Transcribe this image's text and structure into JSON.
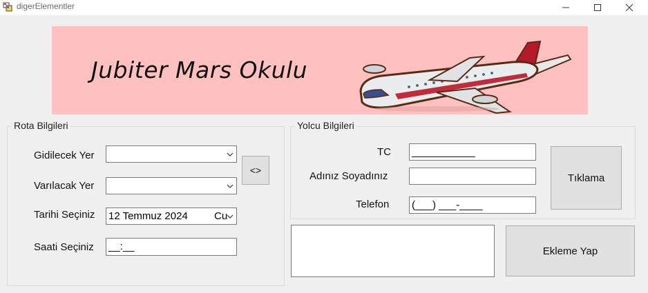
{
  "window": {
    "title": "digerElementler"
  },
  "banner": {
    "title": "Jubiter Mars Okulu",
    "background": "#ffc0c0"
  },
  "route_group": {
    "label": "Rota Bilgileri",
    "destination_label": "Gidilecek Yer",
    "destination_value": "",
    "arrival_label": "Varılacak Yer",
    "arrival_value": "",
    "date_label": "Tarihi Seçiniz",
    "date_value": "12 Temmuz 2024",
    "date_day": "Cu",
    "time_label": "Saati Seçiniz",
    "time_value": "__:__",
    "swap_button": "<>"
  },
  "passenger_group": {
    "label": "Yolcu Bilgileri",
    "tc_label": "TC",
    "tc_value": "___________",
    "name_label": "Adınız Soyadınız",
    "name_value": "",
    "phone_label": "Telefon",
    "phone_value": "(___) ___-____",
    "click_button": "Tıklama"
  },
  "notes_value": "",
  "add_button": "Ekleme Yap"
}
